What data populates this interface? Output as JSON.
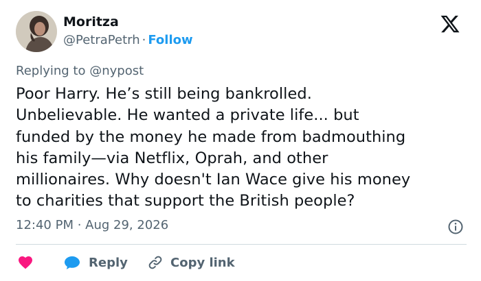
{
  "tweet": {
    "author_name": "Moritza",
    "author_handle": "@PetraPetrh",
    "separator": "·",
    "follow_label": "Follow",
    "replying_prefix": "Replying to",
    "replying_to": "@nypost",
    "text_lines": [
      "Poor Harry. He’s still being bankrolled.",
      "Unbelievable. He wanted a private life... but",
      "funded by the money he made from badmouthing",
      "his family—via Netflix, Oprah, and other",
      "millionaires. Why doesn't Ian Wace give his money",
      "to charities that support the British people?"
    ],
    "timestamp": "12:40 PM · Aug 29, 2026"
  },
  "actions": {
    "like_icon": "heart-icon",
    "reply_label": "Reply",
    "reply_icon": "speech-bubble-icon",
    "copy_label": "Copy link",
    "copy_icon": "link-icon"
  },
  "icons": {
    "brand": "x-logo-icon",
    "info": "info-icon"
  },
  "colors": {
    "accent": "#1d9bf0",
    "like": "#f91880",
    "text": "#0f1419",
    "secondary": "#536471",
    "divider": "#cfd9de"
  }
}
